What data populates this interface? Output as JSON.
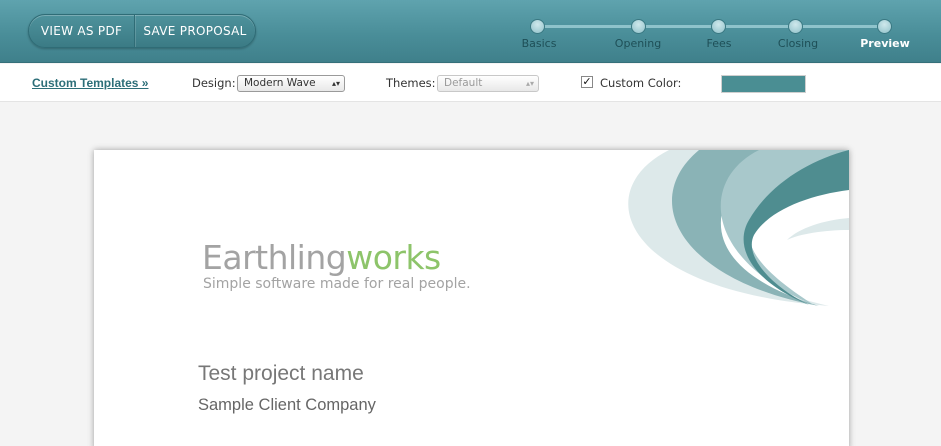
{
  "header": {
    "buttons": {
      "view_pdf": "VIEW AS PDF",
      "save_proposal": "SAVE PROPOSAL"
    },
    "steps": [
      {
        "label": "Basics",
        "active": false
      },
      {
        "label": "Opening",
        "active": false
      },
      {
        "label": "Fees",
        "active": false
      },
      {
        "label": "Closing",
        "active": false
      },
      {
        "label": "Preview",
        "active": true
      }
    ]
  },
  "toolbar": {
    "custom_templates": "Custom Templates »",
    "design_label": "Design:",
    "design_value": "Modern Wave",
    "themes_label": "Themes:",
    "themes_value": "Default",
    "custom_color_label": "Custom Color:",
    "custom_color_checked": true,
    "custom_color_value": "#4a8e93"
  },
  "document": {
    "logo_part1": "Earthling",
    "logo_part2": "works",
    "tagline": "Simple software made for real people.",
    "project_name": "Test project name",
    "client_name": "Sample Client Company"
  },
  "colors": {
    "header": "#4a8e99",
    "accent": "#4a8e93",
    "logo_green": "#8dc46a",
    "logo_gray": "#a3a3a3"
  }
}
